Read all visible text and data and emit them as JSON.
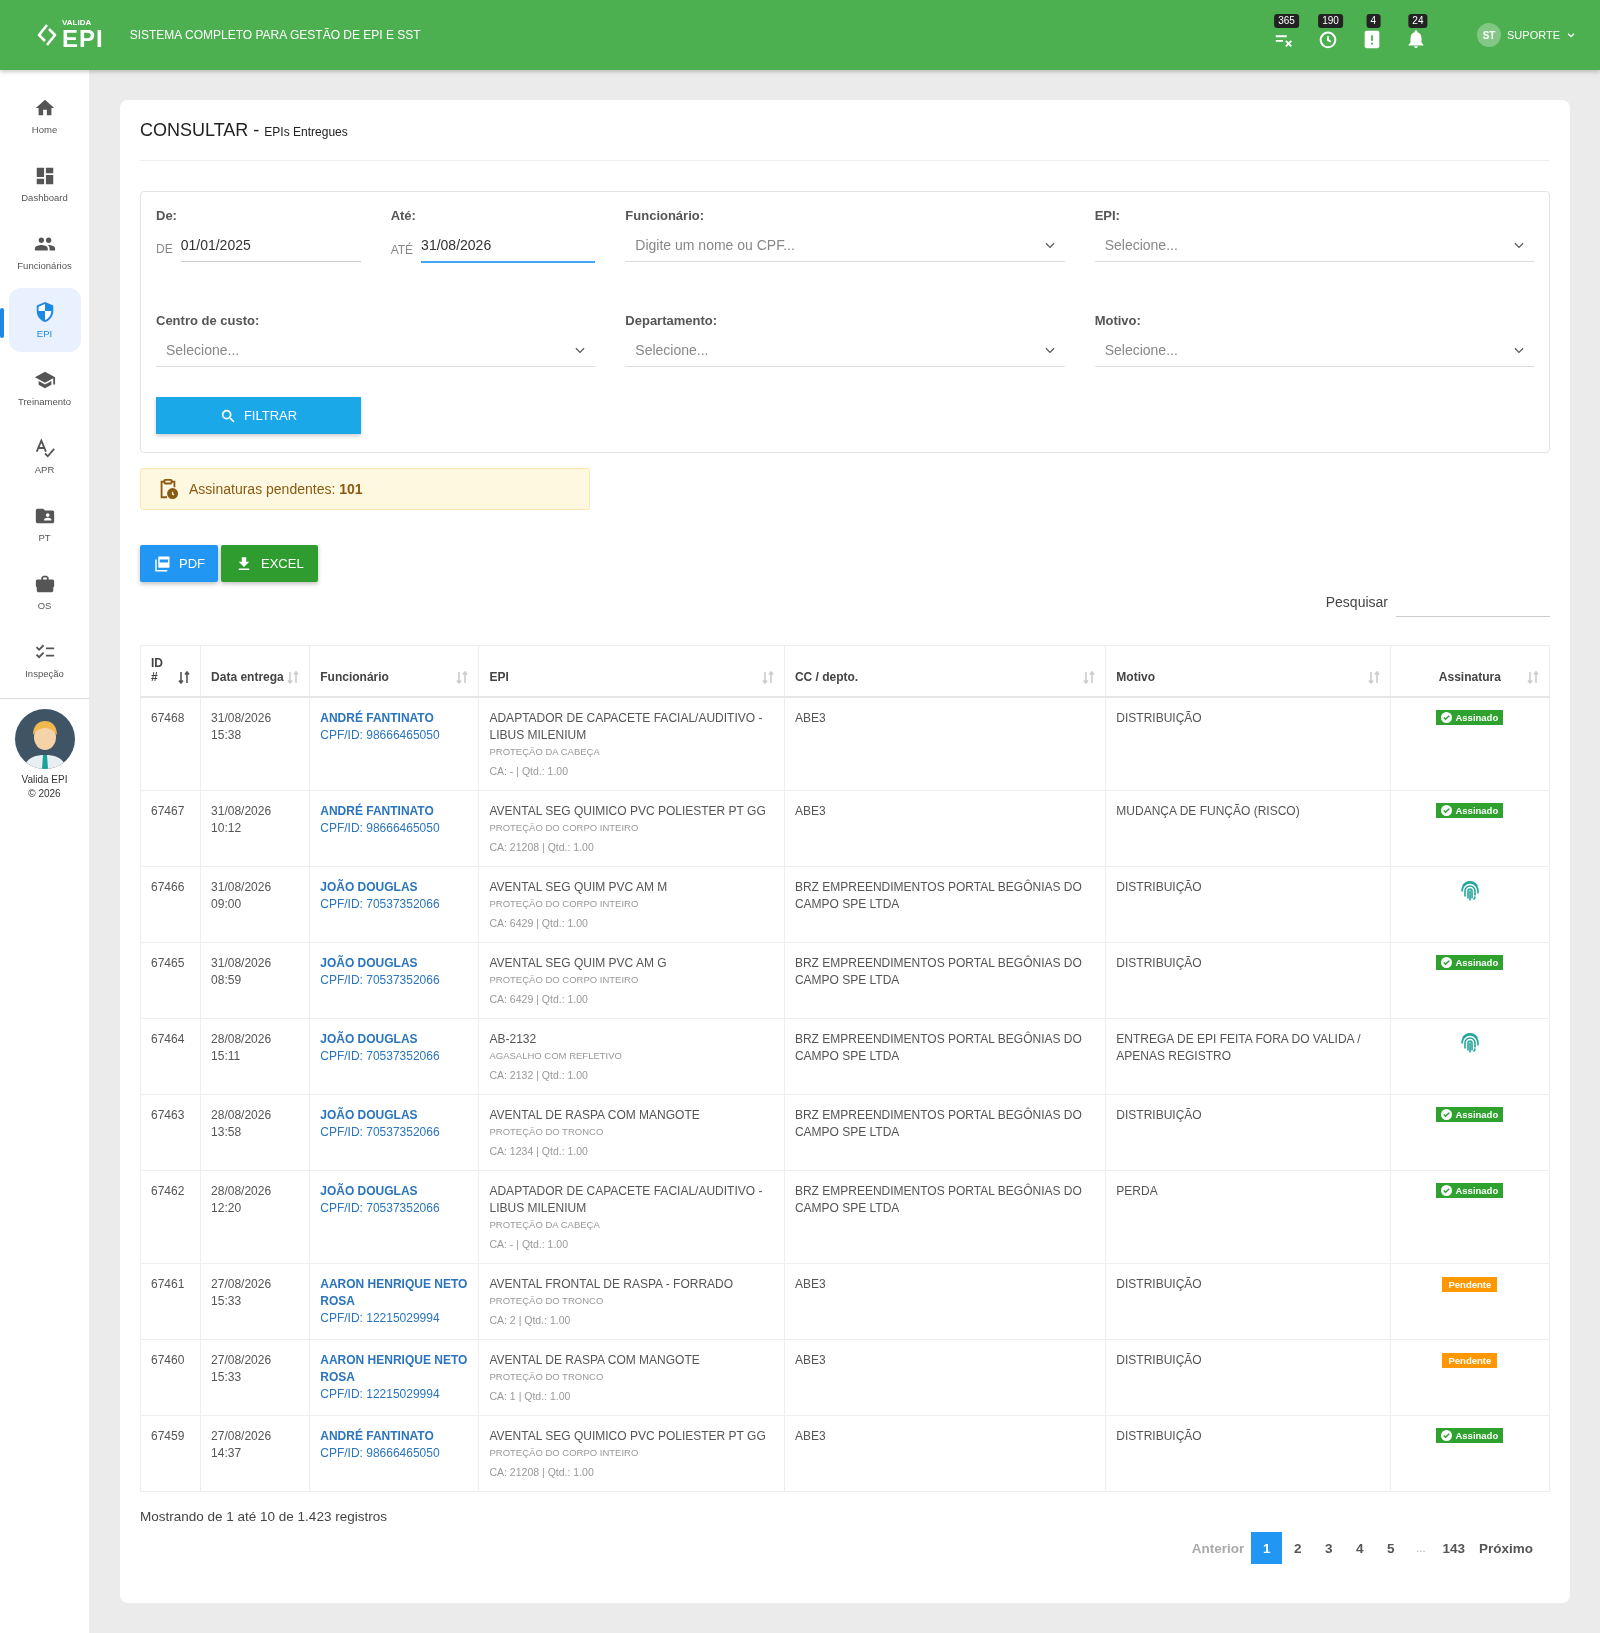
{
  "header": {
    "logo_small": "VALIDA",
    "logo_big": "EPI",
    "tagline": "SISTEMA COMPLETO PARA GESTÃO DE EPI E SST",
    "badges": [
      {
        "kind": "list",
        "count": "365"
      },
      {
        "kind": "clock",
        "count": "190"
      },
      {
        "kind": "clipboard",
        "count": "4"
      },
      {
        "kind": "bell",
        "count": "24"
      }
    ],
    "user": {
      "initials": "ST",
      "name": "SUPORTE"
    }
  },
  "sidebar": {
    "items": [
      {
        "kind": "home",
        "label": "Home",
        "selected": false
      },
      {
        "kind": "dashboard",
        "label": "Dashboard",
        "selected": false
      },
      {
        "kind": "people",
        "label": "Funcionários",
        "selected": false
      },
      {
        "kind": "shield",
        "label": "EPI",
        "selected": true
      },
      {
        "kind": "school",
        "label": "Treinamento",
        "selected": false
      },
      {
        "kind": "spellcheck",
        "label": "APR",
        "selected": false
      },
      {
        "kind": "folder",
        "label": "PT",
        "selected": false
      },
      {
        "kind": "briefcase",
        "label": "OS",
        "selected": false
      },
      {
        "kind": "checklist",
        "label": "Inspeção",
        "selected": false
      }
    ],
    "footer": {
      "name": "Valida EPI",
      "copyright": "© 2026"
    }
  },
  "page": {
    "title": "CONSULTAR",
    "separator": "-",
    "subtitle": "EPIs Entregues"
  },
  "filters": {
    "fields": [
      {
        "kind": "date",
        "label": "De:",
        "prefix": "DE",
        "value": "01/01/2025",
        "focused": false
      },
      {
        "kind": "date",
        "label": "Até:",
        "prefix": "ATÉ",
        "value": "31/08/2026",
        "focused": true
      },
      {
        "kind": "select",
        "label": "Funcionário:",
        "placeholder": "Digite um nome ou CPF..."
      },
      {
        "kind": "select",
        "label": "EPI:",
        "placeholder": "Selecione..."
      },
      {
        "kind": "select",
        "label": "Centro de custo:",
        "placeholder": "Selecione..."
      },
      {
        "kind": "select",
        "label": "Departamento:",
        "placeholder": "Selecione..."
      },
      {
        "kind": "select",
        "label": "Motivo:",
        "placeholder": "Selecione..."
      }
    ],
    "button": "FILTRAR"
  },
  "alert": {
    "text": "Assinaturas pendentes: **101**"
  },
  "export_buttons": [
    {
      "kind": "pdf",
      "label": "PDF"
    },
    {
      "kind": "excel",
      "label": "EXCEL"
    }
  ],
  "search": {
    "label": "Pesquisar"
  },
  "table": {
    "columns": [
      {
        "label": "ID",
        "sub": "#",
        "sorted": true
      },
      {
        "label": "Data entrega",
        "sorted": false
      },
      {
        "label": "Funcionário",
        "sorted": false
      },
      {
        "label": "EPI",
        "sorted": false
      },
      {
        "label": "CC / depto.",
        "sorted": false
      },
      {
        "label": "Motivo",
        "sorted": false
      },
      {
        "label": "Assinatura",
        "sorted": false
      }
    ],
    "rows": [
      {
        "id": "67468",
        "date": "31/08/2026 15:38",
        "employee": "ANDRÉ FANTINATO",
        "cpf": "CPF/ID: 98666465050",
        "epi": "ADAPTADOR DE CAPACETE FACIAL/AUDITIVO - LIBUS MILENIUM",
        "category": "PROTEÇÃO DA CABEÇA",
        "ca": "CA: - | Qtd.: 1.00",
        "cc": "ABE3",
        "motivo": "DISTRIBUIÇÃO",
        "signature": {
          "kind": "signed",
          "label": "Assinado"
        }
      },
      {
        "id": "67467",
        "date": "31/08/2026 10:12",
        "employee": "ANDRÉ FANTINATO",
        "cpf": "CPF/ID: 98666465050",
        "epi": "AVENTAL SEG QUIMICO PVC POLIESTER PT GG",
        "category": "PROTEÇÃO DO CORPO INTEIRO",
        "ca": "CA: 21208 | Qtd.: 1.00",
        "cc": "ABE3",
        "motivo": "MUDANÇA DE FUNÇÃO (RISCO)",
        "signature": {
          "kind": "signed",
          "label": "Assinado"
        }
      },
      {
        "id": "67466",
        "date": "31/08/2026 09:00",
        "employee": "JOÃO DOUGLAS",
        "cpf": "CPF/ID: 70537352066",
        "epi": "AVENTAL SEG QUIM PVC AM M",
        "category": "PROTEÇÃO DO CORPO INTEIRO",
        "ca": "CA: 6429 | Qtd.: 1.00",
        "cc": "BRZ EMPREENDIMENTOS PORTAL BEGÔNIAS DO CAMPO SPE LTDA",
        "motivo": "DISTRIBUIÇÃO",
        "signature": {
          "kind": "fingerprint"
        }
      },
      {
        "id": "67465",
        "date": "31/08/2026 08:59",
        "employee": "JOÃO DOUGLAS",
        "cpf": "CPF/ID: 70537352066",
        "epi": "AVENTAL SEG QUIM PVC AM G",
        "category": "PROTEÇÃO DO CORPO INTEIRO",
        "ca": "CA: 6429 | Qtd.: 1.00",
        "cc": "BRZ EMPREENDIMENTOS PORTAL BEGÔNIAS DO CAMPO SPE LTDA",
        "motivo": "DISTRIBUIÇÃO",
        "signature": {
          "kind": "signed",
          "label": "Assinado"
        }
      },
      {
        "id": "67464",
        "date": "28/08/2026 15:11",
        "employee": "JOÃO DOUGLAS",
        "cpf": "CPF/ID: 70537352066",
        "epi": "AB-2132",
        "category": "AGASALHO COM REFLETIVO",
        "ca": "CA: 2132 | Qtd.: 1.00",
        "cc": "BRZ EMPREENDIMENTOS PORTAL BEGÔNIAS DO CAMPO SPE LTDA",
        "motivo": "ENTREGA DE EPI FEITA FORA DO VALIDA / APENAS REGISTRO",
        "signature": {
          "kind": "fingerprint"
        }
      },
      {
        "id": "67463",
        "date": "28/08/2026 13:58",
        "employee": "JOÃO DOUGLAS",
        "cpf": "CPF/ID: 70537352066",
        "epi": "AVENTAL DE RASPA COM MANGOTE",
        "category": "PROTEÇÃO DO TRONCO",
        "ca": "CA: 1234 | Qtd.: 1.00",
        "cc": "BRZ EMPREENDIMENTOS PORTAL BEGÔNIAS DO CAMPO SPE LTDA",
        "motivo": "DISTRIBUIÇÃO",
        "signature": {
          "kind": "signed",
          "label": "Assinado"
        }
      },
      {
        "id": "67462",
        "date": "28/08/2026 12:20",
        "employee": "JOÃO DOUGLAS",
        "cpf": "CPF/ID: 70537352066",
        "epi": "ADAPTADOR DE CAPACETE FACIAL/AUDITIVO - LIBUS MILENIUM",
        "category": "PROTEÇÃO DA CABEÇA",
        "ca": "CA: - | Qtd.: 1.00",
        "cc": "BRZ EMPREENDIMENTOS PORTAL BEGÔNIAS DO CAMPO SPE LTDA",
        "motivo": "PERDA",
        "signature": {
          "kind": "signed",
          "label": "Assinado"
        }
      },
      {
        "id": "67461",
        "date": "27/08/2026 15:33",
        "employee": "AARON HENRIQUE NETO ROSA",
        "cpf": "CPF/ID: 12215029994",
        "epi": "AVENTAL FRONTAL DE RASPA - FORRADO",
        "category": "PROTEÇÃO DO TRONCO",
        "ca": "CA: 2 | Qtd.: 1.00",
        "cc": "ABE3",
        "motivo": "DISTRIBUIÇÃO",
        "signature": {
          "kind": "pending",
          "label": "Pendente"
        }
      },
      {
        "id": "67460",
        "date": "27/08/2026 15:33",
        "employee": "AARON HENRIQUE NETO ROSA",
        "cpf": "CPF/ID: 12215029994",
        "epi": "AVENTAL DE RASPA COM MANGOTE",
        "category": "PROTEÇÃO DO TRONCO",
        "ca": "CA: 1 | Qtd.: 1.00",
        "cc": "ABE3",
        "motivo": "DISTRIBUIÇÃO",
        "signature": {
          "kind": "pending",
          "label": "Pendente"
        }
      },
      {
        "id": "67459",
        "date": "27/08/2026 14:37",
        "employee": "ANDRÉ FANTINATO",
        "cpf": "CPF/ID: 98666465050",
        "epi": "AVENTAL SEG QUIMICO PVC POLIESTER PT GG",
        "category": "PROTEÇÃO DO CORPO INTEIRO",
        "ca": "CA: 21208 | Qtd.: 1.00",
        "cc": "ABE3",
        "motivo": "DISTRIBUIÇÃO",
        "signature": {
          "kind": "signed",
          "label": "Assinado"
        }
      }
    ]
  },
  "footer_info": "Mostrando de 1 até 10 de 1.423 registros",
  "pagination": {
    "previous": "Anterior",
    "next": "Próximo",
    "pages": [
      {
        "kind": "page",
        "label": "1",
        "selected": true
      },
      {
        "kind": "page",
        "label": "2",
        "selected": false
      },
      {
        "kind": "page",
        "label": "3",
        "selected": false
      },
      {
        "kind": "page",
        "label": "4",
        "selected": false
      },
      {
        "kind": "page",
        "label": "5",
        "selected": false
      },
      {
        "kind": "ellipsis",
        "label": "..."
      },
      {
        "kind": "page",
        "label": "143",
        "selected": false
      }
    ]
  }
}
